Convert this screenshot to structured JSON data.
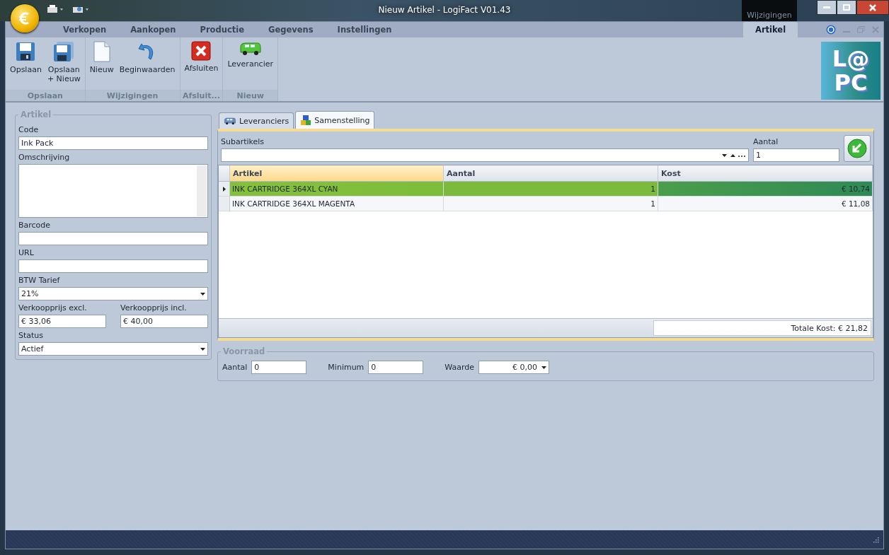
{
  "window": {
    "title": "Nieuw Artikel - LogiFact V01.43",
    "context_label": "Wijzigingen"
  },
  "ribbon": {
    "tabs": [
      {
        "label": "Verkopen",
        "selected": false
      },
      {
        "label": "Aankopen",
        "selected": false
      },
      {
        "label": "Productie",
        "selected": false
      },
      {
        "label": "Gegevens",
        "selected": false
      },
      {
        "label": "Instellingen",
        "selected": false
      },
      {
        "label": "Artikel",
        "selected": true,
        "kind": "context"
      }
    ],
    "groups": [
      {
        "label": "Opslaan",
        "buttons": [
          {
            "label": "Opslaan"
          },
          {
            "label": "Opslaan\n+ Nieuw"
          }
        ]
      },
      {
        "label": "Wijzigingen",
        "buttons": [
          {
            "label": "Nieuw"
          },
          {
            "label": "Beginwaarden"
          }
        ]
      },
      {
        "label": "Afsluit...",
        "buttons": [
          {
            "label": "Afsluiten"
          }
        ]
      },
      {
        "label": "Nieuw",
        "buttons": [
          {
            "label": "Leverancier"
          }
        ]
      }
    ]
  },
  "logo": [
    "L@",
    "PC"
  ],
  "artikel": {
    "title": "Artikel",
    "fields": [
      {
        "label": "Code",
        "value": "Ink Pack",
        "kind": "text"
      },
      {
        "label": "Omschrijving",
        "kind": "textarea"
      },
      {
        "label": "Barcode",
        "kind": "text"
      },
      {
        "label": "URL",
        "kind": "text"
      },
      {
        "label": "BTW Tarief",
        "value": "21%",
        "kind": "select"
      },
      {
        "kind": "pair",
        "items": [
          {
            "label": "Verkoopprijs excl.",
            "value": "€ 33,06"
          },
          {
            "label": "Verkoopprijs incl.",
            "value": "€ 40,00"
          }
        ]
      },
      {
        "label": "Status",
        "value": "Actief",
        "kind": "select"
      }
    ]
  },
  "tabs": [
    {
      "label": "Leveranciers",
      "selected": false
    },
    {
      "label": "Samenstelling",
      "selected": true
    }
  ],
  "samenstelling": {
    "subartikels_label": "Subartikels",
    "aantal_label": "Aantal",
    "aantal_value": "1",
    "columns": [
      "Artikel",
      "Aantal",
      "Kost"
    ],
    "rows": [
      {
        "cells": [
          "INK CARTRIDGE 364XL CYAN",
          "1",
          "€ 10,74"
        ],
        "selected": true
      },
      {
        "cells": [
          "INK CARTRIDGE 364XL MAGENTA",
          "1",
          "€ 11,08"
        ],
        "selected": false
      }
    ],
    "total": "Totale Kost: € 21,82"
  },
  "voorraad": {
    "title": "Voorraad",
    "fields": [
      {
        "label": "Aantal",
        "value": "0",
        "kind": "text"
      },
      {
        "label": "Minimum",
        "value": "0",
        "kind": "text"
      },
      {
        "label": "Waarde",
        "value": "€ 0,00",
        "kind": "select"
      }
    ]
  }
}
